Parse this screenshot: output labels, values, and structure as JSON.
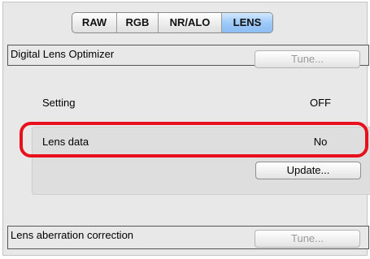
{
  "tabs": [
    {
      "label": "RAW",
      "active": false
    },
    {
      "label": "RGB",
      "active": false
    },
    {
      "label": "NR/ALO",
      "active": false
    },
    {
      "label": "LENS",
      "active": true
    }
  ],
  "digital_lens_optimizer": {
    "title": "Digital Lens Optimizer",
    "tune_label": "Tune...",
    "setting_label": "Setting",
    "setting_value": "OFF",
    "lens_data_label": "Lens data",
    "lens_data_value": "No",
    "update_label": "Update..."
  },
  "lens_aberration_correction": {
    "title": "Lens aberration correction",
    "tune_label": "Tune..."
  },
  "colors": {
    "highlight": "#e8111b",
    "active_tab": "#9fcaf8"
  }
}
